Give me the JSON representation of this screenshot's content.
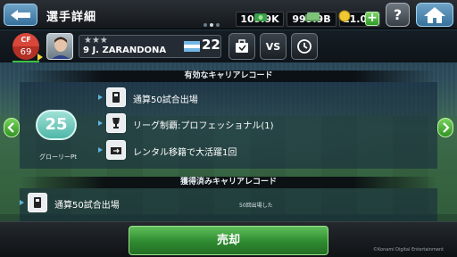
{
  "header": {
    "title": "選手詳細",
    "pages": 3,
    "active_page": 1
  },
  "currency": {
    "gp": "109.9K",
    "coins": "999.9B",
    "myclub_coins": "11.0M"
  },
  "player": {
    "position": "CF",
    "rating": "69",
    "stars": "★★★",
    "name": "9 J. ZARANDONA",
    "level": "22",
    "vs_label": "VS"
  },
  "active_records": {
    "header": "有効なキャリアレコード",
    "points": "25",
    "points_label": "グローリーPt",
    "items": [
      {
        "label": "通算50試合出場",
        "icon": "stadium-icon"
      },
      {
        "label": "リーグ制覇:プロフェッショナル(1)",
        "icon": "trophy-icon"
      },
      {
        "label": "レンタル移籍で大活躍1回",
        "icon": "transfer-icon"
      }
    ]
  },
  "earned_records": {
    "header": "獲得済みキャリアレコード",
    "items": [
      {
        "label": "通算50試合出場",
        "note": "50回出場した",
        "icon": "stadium-icon"
      }
    ]
  },
  "footer": {
    "sell_label": "売却",
    "copyright": "©Konami Digital Entertainment"
  },
  "colors": {
    "accent_green": "#2e8a2f",
    "position_red": "#d8473a",
    "score_teal": "#4fb7a8"
  }
}
